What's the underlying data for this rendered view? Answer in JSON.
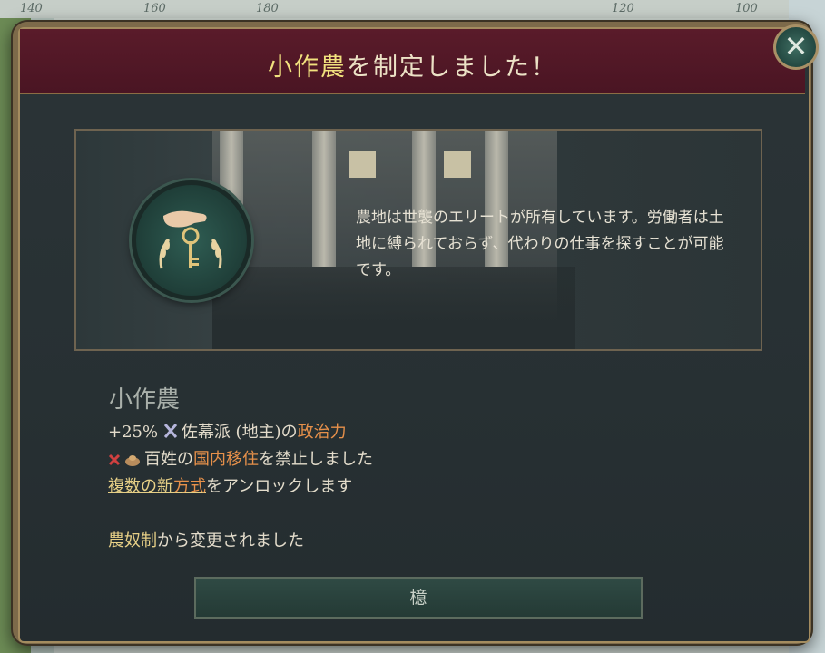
{
  "map_ticks": [
    "140",
    "160",
    "180",
    "120",
    "100"
  ],
  "dialog": {
    "title_highlight": "小作農",
    "title_rest": "を制定しました！",
    "close_label": "✕",
    "description": "農地は世襲のエリートが所有しています。労働者は土地に縛られておらず、代わりの仕事を探すことが可能です。",
    "law_name": "小作農",
    "effects": [
      {
        "value": "+25%",
        "group": "佐幕派 (地主)",
        "particle": "の",
        "attr": "政治力"
      },
      {
        "group": "百姓",
        "particle": "の",
        "attr": "国内移住",
        "tail": "を禁止しました"
      },
      {
        "link_a": "複数の新",
        "link_b": "方式",
        "tail": "をアンロックします"
      }
    ],
    "changed_from": {
      "law": "農奴制",
      "tail": "から変更されました"
    },
    "ok_label": "檍"
  }
}
